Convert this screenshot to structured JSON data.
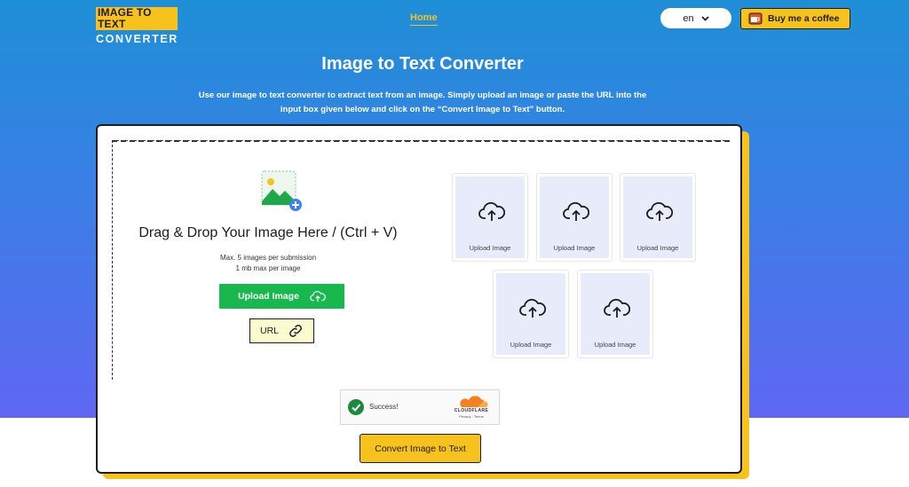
{
  "header": {
    "logo_top": "IMAGE TO TEXT",
    "logo_bottom": "CONVERTER",
    "nav_home": "Home",
    "language": "en",
    "coffee_label": "Buy me a coffee"
  },
  "hero": {
    "title": "Image to Text Converter",
    "description": "Use our image to text converter to extract text from an image. Simply upload an image or paste the URL into the input box given below and click on the “Convert Image to Text” button."
  },
  "upload": {
    "drop_title": "Drag & Drop Your Image Here / (Ctrl + V)",
    "limit_line1": "Max. 5 images per submission",
    "limit_line2": "1 mb max per image",
    "upload_label": "Upload Image",
    "url_label": "URL"
  },
  "slots": [
    {
      "label": "Upload Image",
      "icon": "cloud-upload-icon"
    },
    {
      "label": "Upload Image",
      "icon": "cloud-upload-icon"
    },
    {
      "label": "Upload Image",
      "icon": "cloud-upload-icon"
    },
    {
      "label": "Upload Image",
      "icon": "cloud-upload-icon"
    },
    {
      "label": "Upload Image",
      "icon": "cloud-upload-icon"
    }
  ],
  "captcha": {
    "status": "Success!",
    "provider": "CLOUDFLARE",
    "privacy": "Privacy",
    "terms": "Terms"
  },
  "actions": {
    "convert_label": "Convert Image to Text"
  },
  "colors": {
    "accent": "#f7c21b",
    "upload_green": "#18b84f",
    "gradient_top": "#1e8fd6",
    "gradient_bottom": "#5f67f2"
  }
}
